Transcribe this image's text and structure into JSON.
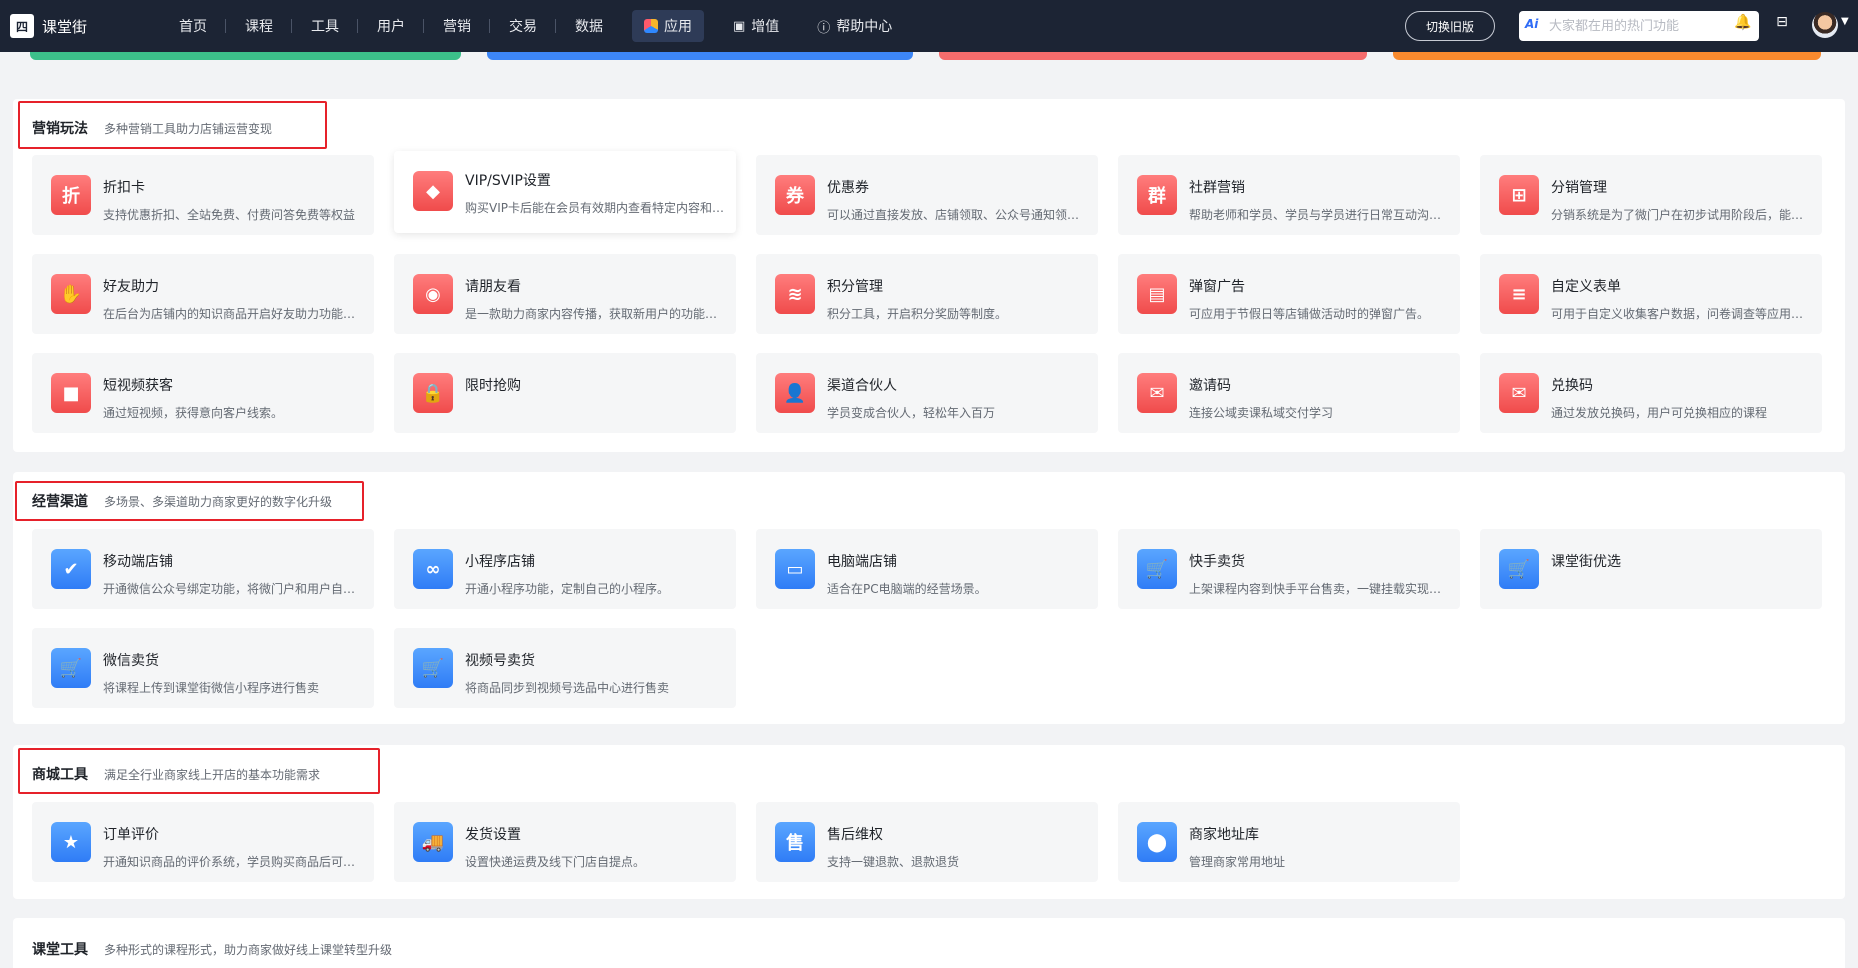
{
  "brand": {
    "logo_mark": "四",
    "name": "课堂街"
  },
  "nav": [
    {
      "label": "首页"
    },
    {
      "label": "课程"
    },
    {
      "label": "工具"
    },
    {
      "label": "用户"
    },
    {
      "label": "营销"
    },
    {
      "label": "交易"
    },
    {
      "label": "数据"
    },
    {
      "label": "应用",
      "active": true
    },
    {
      "label": "增值"
    },
    {
      "label": "帮助中心"
    }
  ],
  "header": {
    "switch_label": "切换旧版",
    "search_placeholder": "大家都在用的热门功能",
    "ai_badge": "Ai"
  },
  "sections": [
    {
      "title": "营销玩法",
      "desc": "多种营销工具助力店铺运营变现",
      "cards": [
        {
          "title": "折扣卡",
          "desc": "支持优惠折扣、全站免费、付费问答免费等权益",
          "icon": "discount-card-icon",
          "glyph": "折"
        },
        {
          "title": "VIP/SVIP设置",
          "desc": "购买VIP卡后能在会员有效期内查看特定内容和权益",
          "icon": "diamond-icon",
          "glyph": "◆"
        },
        {
          "title": "优惠券",
          "desc": "可以通过直接发放、店铺领取、公众号通知领取等方式",
          "icon": "coupon-icon",
          "glyph": "券"
        },
        {
          "title": "社群营销",
          "desc": "帮助老师和学员、学员与学员进行日常互动沟通交流",
          "icon": "community-icon",
          "glyph": "群"
        },
        {
          "title": "分销管理",
          "desc": "分销系统是为了微门户在初步试用阶段后，能够快速推广",
          "icon": "org-chart-icon",
          "glyph": "⊞"
        },
        {
          "title": "好友助力",
          "desc": "在后台为店铺内的知识商品开启好友助力功能，实现裂变",
          "icon": "handshake-icon",
          "glyph": "✋"
        },
        {
          "title": "请朋友看",
          "desc": "是一款助力商家内容传播，获取新用户的功能，增加曝光",
          "icon": "eye-icon",
          "glyph": "◉"
        },
        {
          "title": "积分管理",
          "desc": "积分工具，开启积分奖励等制度。",
          "icon": "coins-icon",
          "glyph": "≋"
        },
        {
          "title": "弹窗广告",
          "desc": "可应用于节假日等店铺做活动时的弹窗广告。",
          "icon": "popup-ad-icon",
          "glyph": "▤"
        },
        {
          "title": "自定义表单",
          "desc": "可用于自定义收集客户数据，问卷调查等应用场景",
          "icon": "form-icon",
          "glyph": "≡"
        },
        {
          "title": "短视频获客",
          "desc": "通过短视频，获得意向客户线索。",
          "icon": "video-camera-icon",
          "glyph": "■"
        },
        {
          "title": "限时抢购",
          "desc": "",
          "icon": "lock-bag-icon",
          "glyph": "🔒"
        },
        {
          "title": "渠道合伙人",
          "desc": "学员变成合伙人，轻松年入百万",
          "icon": "partner-icon",
          "glyph": "👤"
        },
        {
          "title": "邀请码",
          "desc": "连接公域卖课私域交付学习",
          "icon": "invite-envelope-icon",
          "glyph": "✉"
        },
        {
          "title": "兑换码",
          "desc": "通过发放兑换码，用户可兑换相应的课程",
          "icon": "redeem-envelope-icon",
          "glyph": "✉"
        }
      ]
    },
    {
      "title": "经营渠道",
      "desc": "多场景、多渠道助力商家更好的数字化升级",
      "cards": [
        {
          "title": "移动端店铺",
          "desc": "开通微信公众号绑定功能，将微门户和用户自有公众号打通",
          "icon": "mobile-shop-icon",
          "glyph": "✔"
        },
        {
          "title": "小程序店铺",
          "desc": "开通小程序功能，定制自己的小程序。",
          "icon": "miniprogram-icon",
          "glyph": "∞"
        },
        {
          "title": "电脑端店铺",
          "desc": "适合在PC电脑端的经营场景。",
          "icon": "monitor-icon",
          "glyph": "▭"
        },
        {
          "title": "快手卖货",
          "desc": "上架课程内容到快手平台售卖，一键挂载实现带货",
          "icon": "cart-kuaishou-icon",
          "glyph": "🛒"
        },
        {
          "title": "课堂街优选",
          "desc": "",
          "icon": "cart-select-icon",
          "glyph": "🛒"
        },
        {
          "title": "微信卖货",
          "desc": "将课程上传到课堂街微信小程序进行售卖",
          "icon": "cart-wechat-icon",
          "glyph": "🛒"
        },
        {
          "title": "视频号卖货",
          "desc": "将商品同步到视频号选品中心进行售卖",
          "icon": "cart-channels-icon",
          "glyph": "🛒"
        }
      ]
    },
    {
      "title": "商城工具",
      "desc": "满足全行业商家线上开店的基本功能需求",
      "cards": [
        {
          "title": "订单评价",
          "desc": "开通知识商品的评价系统，学员购买商品后可进行评价",
          "icon": "star-icon",
          "glyph": "★"
        },
        {
          "title": "发货设置",
          "desc": "设置快递运费及线下门店自提点。",
          "icon": "truck-icon",
          "glyph": "🚚"
        },
        {
          "title": "售后维权",
          "desc": "支持一键退款、退款退货",
          "icon": "shield-after-sale-icon",
          "glyph": "售"
        },
        {
          "title": "商家地址库",
          "desc": "管理商家常用地址",
          "icon": "location-pin-icon",
          "glyph": "⬤"
        }
      ]
    },
    {
      "title": "课堂工具",
      "desc": "多种形式的课程形式，助力商家做好线上课堂转型升级",
      "cards": []
    }
  ],
  "colors": {
    "nav_bg": "#1c2434",
    "highlight_border": "#e6212a",
    "marketing_icon": "#f04b4b",
    "channel_icon": "#2f7cf6",
    "banner_green": "#3cc08a",
    "banner_blue": "#3d86f6",
    "banner_red": "#f56c6c",
    "banner_orange": "#f98a2e"
  }
}
